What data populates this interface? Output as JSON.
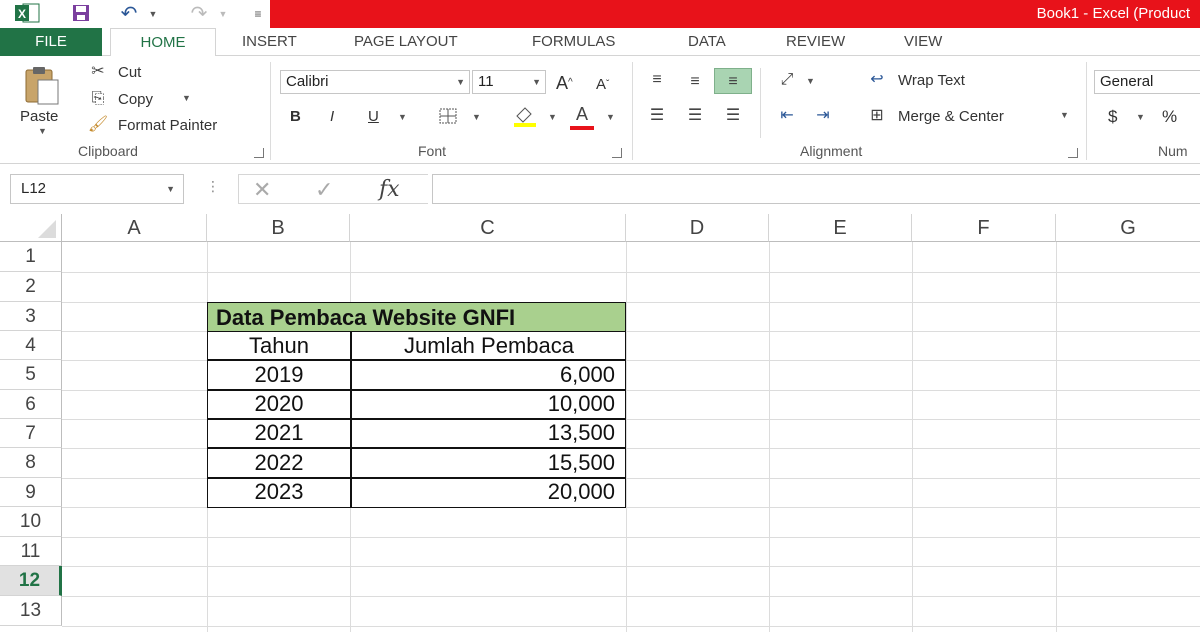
{
  "titlebar": {
    "title": "Book1 - Excel (Product",
    "excel_icon": "X",
    "accent": "#217346",
    "title_bg": "#e8121a"
  },
  "tabs": [
    {
      "label": "FILE"
    },
    {
      "label": "HOME"
    },
    {
      "label": "INSERT"
    },
    {
      "label": "PAGE LAYOUT"
    },
    {
      "label": "FORMULAS"
    },
    {
      "label": "DATA"
    },
    {
      "label": "REVIEW"
    },
    {
      "label": "VIEW"
    }
  ],
  "ribbon": {
    "clipboard": {
      "paste": "Paste",
      "cut": "Cut",
      "copy": "Copy",
      "format_painter": "Format Painter",
      "group": "Clipboard"
    },
    "font": {
      "name": "Calibri",
      "size": "11",
      "bold": "B",
      "italic": "I",
      "underline": "U",
      "grow": "A",
      "shrink": "A",
      "font_color": "A",
      "group": "Font"
    },
    "alignment": {
      "wrap_text": "Wrap Text",
      "merge_center": "Merge & Center",
      "group": "Alignment"
    },
    "number": {
      "format": "General",
      "currency": "$",
      "percent": "%",
      "group": "Num"
    }
  },
  "formula_bar": {
    "name_box": "L12",
    "fx": "fx",
    "formula": ""
  },
  "grid": {
    "columns": [
      "A",
      "B",
      "C",
      "D",
      "E",
      "F",
      "G"
    ],
    "rows": [
      "1",
      "2",
      "3",
      "4",
      "5",
      "6",
      "7",
      "8",
      "9",
      "10",
      "11",
      "12",
      "13"
    ],
    "active_row": "12",
    "table": {
      "title": "Data Pembaca Website GNFI",
      "title_bg": "#a9d08e",
      "headers": [
        "Tahun",
        "Jumlah Pembaca"
      ],
      "rows": [
        [
          "2019",
          "6,000"
        ],
        [
          "2020",
          "10,000"
        ],
        [
          "2021",
          "13,500"
        ],
        [
          "2022",
          "15,500"
        ],
        [
          "2023",
          "20,000"
        ]
      ]
    }
  }
}
